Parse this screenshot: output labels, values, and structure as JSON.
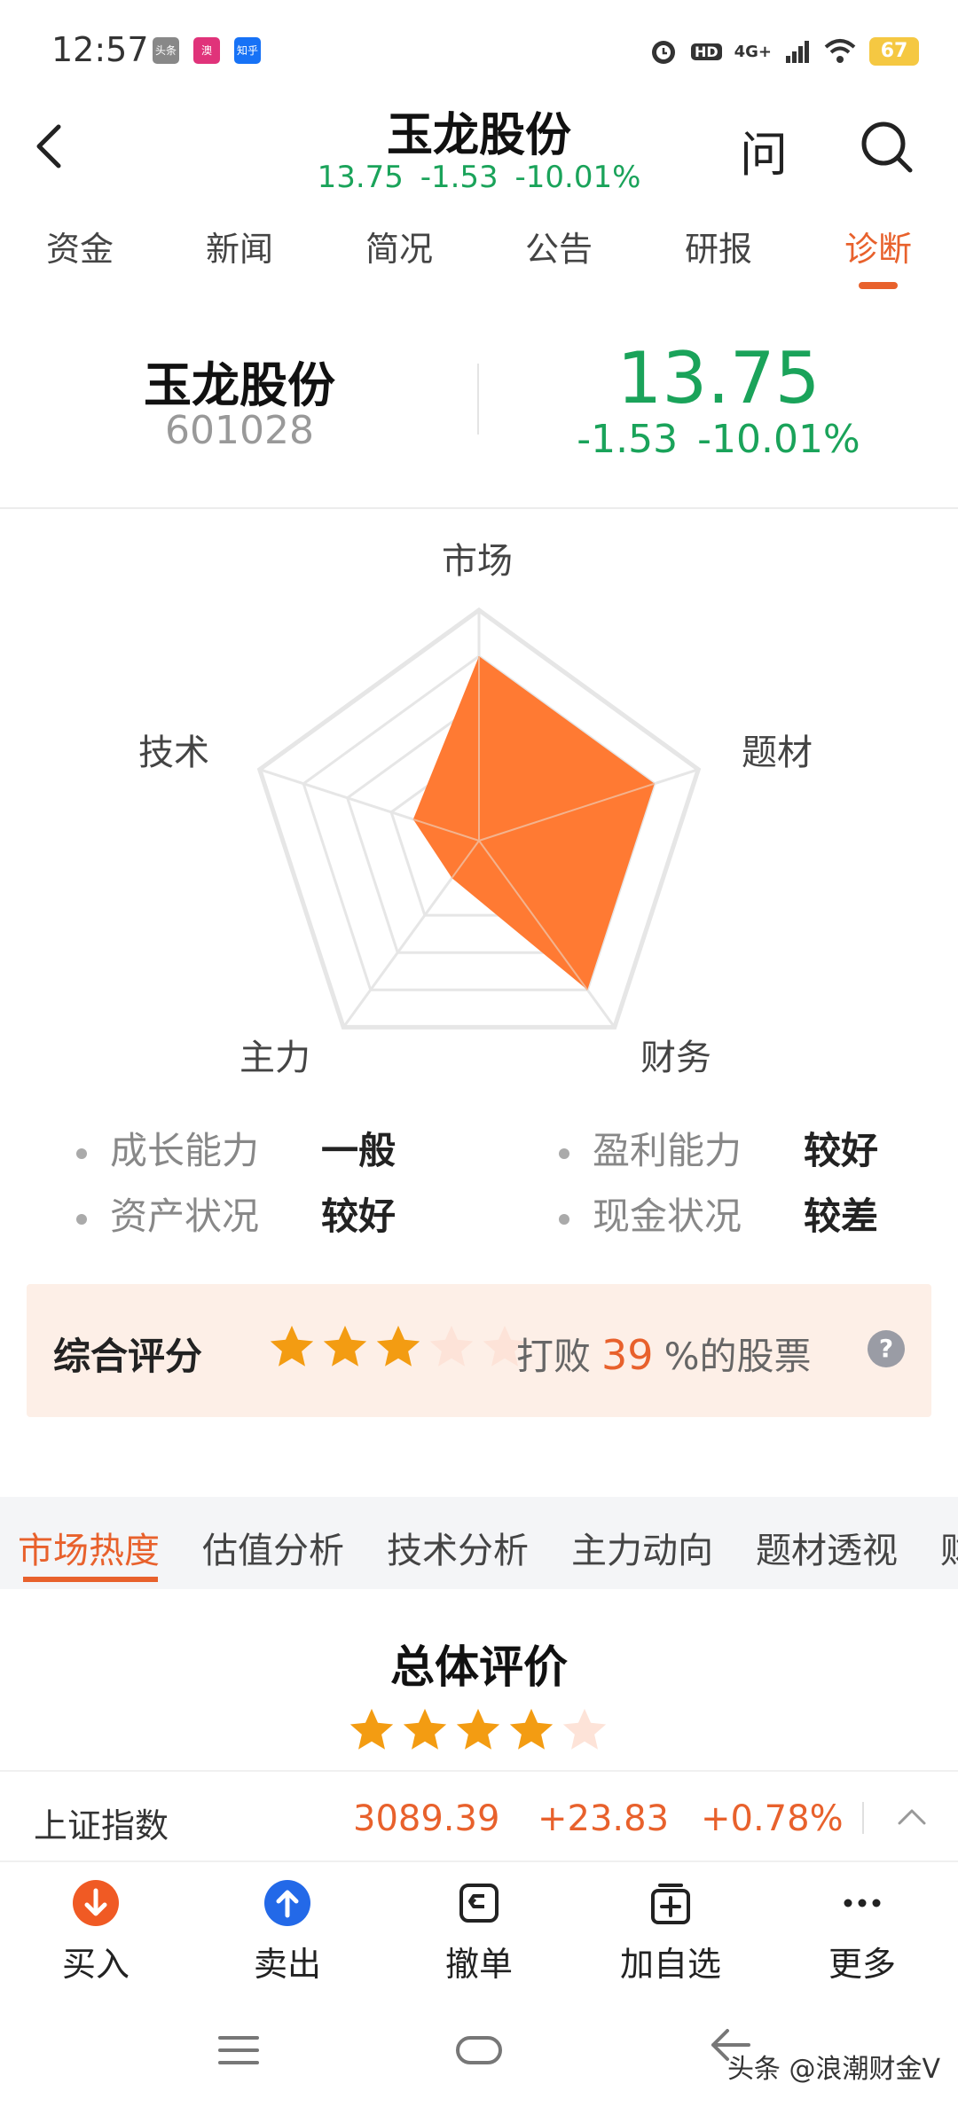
{
  "status_bar": {
    "time": "12:57",
    "apps": [
      "头条",
      "澳",
      "知乎"
    ],
    "network": "4G+",
    "hd": "HD",
    "battery": "67"
  },
  "header": {
    "title": "玉龙股份",
    "price": "13.75",
    "change": "-1.53",
    "change_pct": "-10.01%",
    "ask_label": "问"
  },
  "tabs": [
    "资金",
    "新闻",
    "简况",
    "公告",
    "研报",
    "诊断"
  ],
  "active_tab": "诊断",
  "summary": {
    "name": "玉龙股份",
    "code": "601028",
    "price": "13.75",
    "change": "-1.53",
    "change_pct": "-10.01%"
  },
  "radar": {
    "axes": [
      "市场",
      "题材",
      "财务",
      "主力",
      "技术"
    ],
    "values": [
      0.8,
      0.8,
      0.8,
      0.2,
      0.3
    ],
    "fill_color": "#ff7a33"
  },
  "metrics": [
    {
      "label": "成长能力",
      "value": "一般"
    },
    {
      "label": "盈利能力",
      "value": "较好"
    },
    {
      "label": "资产状况",
      "value": "较好"
    },
    {
      "label": "现金状况",
      "value": "较差"
    }
  ],
  "rating": {
    "title": "综合评分",
    "stars": 3,
    "max_stars": 5,
    "beat_prefix": "打败",
    "beat_pct": "39",
    "beat_suffix": "%的股票",
    "help": "?"
  },
  "analysis_tabs": [
    "市场热度",
    "估值分析",
    "技术分析",
    "主力动向",
    "题材透视",
    "财"
  ],
  "active_analysis_tab": "市场热度",
  "overall": {
    "title": "总体评价",
    "stars": 4,
    "max_stars": 5
  },
  "index_bar": {
    "name": "上证指数",
    "value": "3089.39",
    "change": "+23.83",
    "change_pct": "+0.78%"
  },
  "actions": [
    {
      "label": "买入",
      "icon": "buy-arrow-down-icon"
    },
    {
      "label": "卖出",
      "icon": "sell-arrow-up-icon"
    },
    {
      "label": "撤单",
      "icon": "cancel-order-icon"
    },
    {
      "label": "加自选",
      "icon": "add-watchlist-icon"
    },
    {
      "label": "更多",
      "icon": "more-dots-icon"
    }
  ],
  "watermark": "头条 @浪潮财金V",
  "colors": {
    "down_green": "#1aa35a",
    "accent_orange": "#e8612c",
    "star_orange": "#f39c12",
    "star_faded": "#fde3d8"
  }
}
